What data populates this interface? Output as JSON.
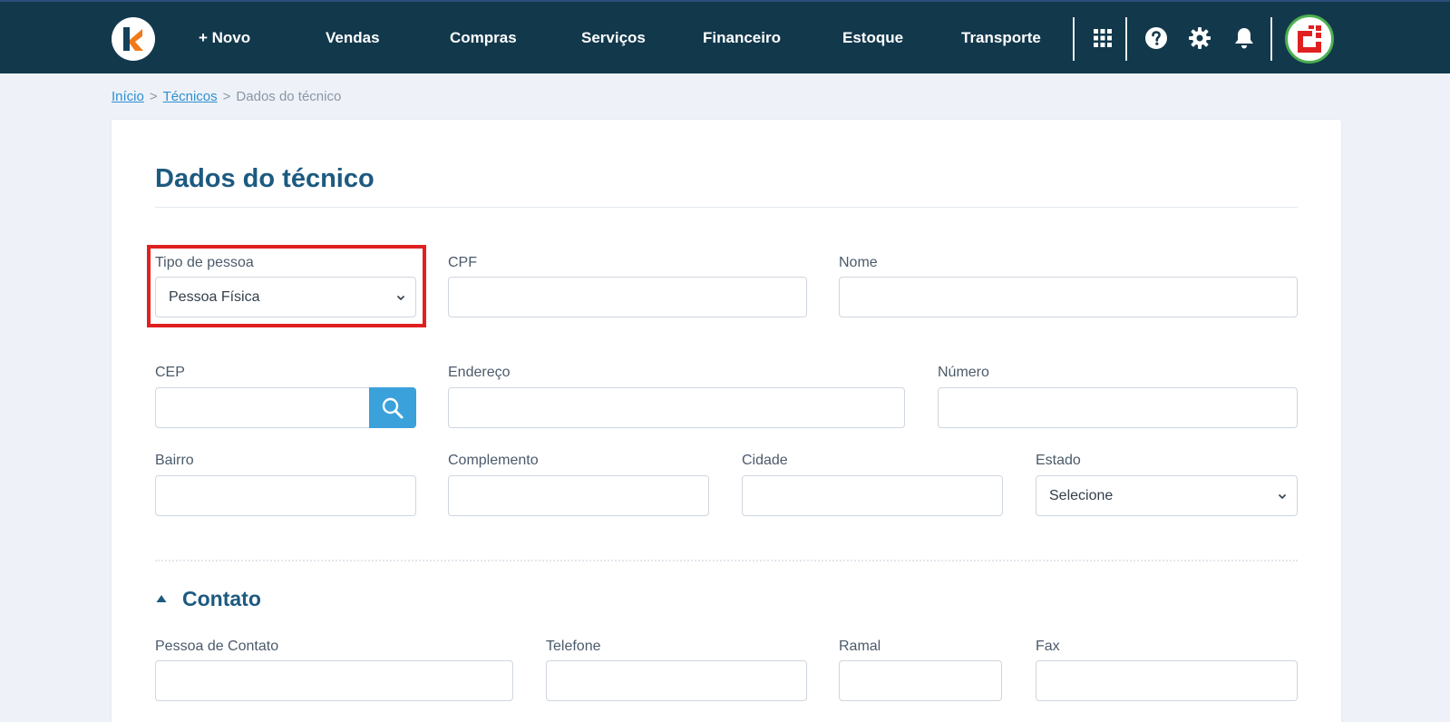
{
  "nav": {
    "items": [
      "+ Novo",
      "Vendas",
      "Compras",
      "Serviços",
      "Financeiro",
      "Estoque",
      "Transporte"
    ],
    "icons": [
      "apps-grid-icon",
      "help-icon",
      "gear-icon",
      "bell-icon"
    ]
  },
  "breadcrumb": {
    "home": "Início",
    "parent": "Técnicos",
    "current": "Dados do técnico",
    "separator": ">"
  },
  "page": {
    "title": "Dados do técnico"
  },
  "form": {
    "tipo_pessoa": {
      "label": "Tipo de pessoa",
      "value": "Pessoa Física"
    },
    "cpf": {
      "label": "CPF",
      "value": ""
    },
    "nome": {
      "label": "Nome",
      "value": ""
    },
    "cep": {
      "label": "CEP",
      "value": ""
    },
    "endereco": {
      "label": "Endereço",
      "value": ""
    },
    "numero": {
      "label": "Número",
      "value": ""
    },
    "bairro": {
      "label": "Bairro",
      "value": ""
    },
    "complemento": {
      "label": "Complemento",
      "value": ""
    },
    "cidade": {
      "label": "Cidade",
      "value": ""
    },
    "estado": {
      "label": "Estado",
      "value": "Selecione"
    }
  },
  "contato": {
    "title": "Contato",
    "pessoa_contato": {
      "label": "Pessoa de Contato",
      "value": ""
    },
    "telefone": {
      "label": "Telefone",
      "value": ""
    },
    "ramal": {
      "label": "Ramal",
      "value": ""
    },
    "fax": {
      "label": "Fax",
      "value": ""
    }
  },
  "colors": {
    "navbar": "#12384c",
    "title": "#1d5a80",
    "accent": "#3ba1db",
    "highlight": "#e02020",
    "logo": "#f07a1a"
  }
}
